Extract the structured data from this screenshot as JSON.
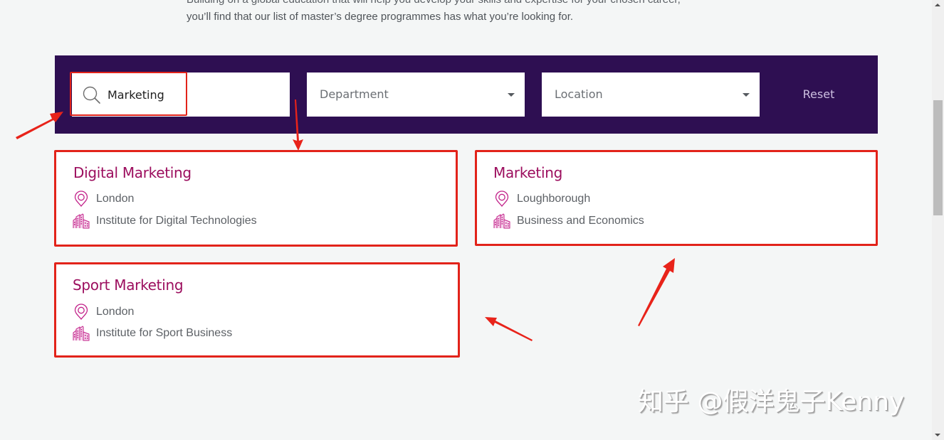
{
  "intro": {
    "line_partial": "Building on a global education that will help you develop your skills and expertise for your chosen career,",
    "line_full": "you’ll find that our list of master’s degree programmes has what you’re looking for."
  },
  "filters": {
    "search": {
      "value": "Marketing",
      "icon": "search-icon"
    },
    "department": {
      "label": "Department",
      "icon": "caret-down-icon"
    },
    "location": {
      "label": "Location",
      "icon": "caret-down-icon"
    },
    "reset_label": "Reset"
  },
  "results": [
    {
      "title": "Digital Marketing",
      "location": "London",
      "department": "Institute for Digital Technologies"
    },
    {
      "title": "Marketing",
      "location": "Loughborough",
      "department": "Business and Economics"
    },
    {
      "title": "Sport Marketing",
      "location": "London",
      "department": "Institute for Sport Business"
    }
  ],
  "colors": {
    "page_background": "#f4f6f6",
    "filter_bar": "#2e0f52",
    "title_accent": "#9c0e5e",
    "icon_accent": "#c2228a",
    "annotation_red": "#e2231a",
    "reset_text": "#cdbfe0"
  },
  "watermark": "知乎 @假洋鬼子Kenny"
}
